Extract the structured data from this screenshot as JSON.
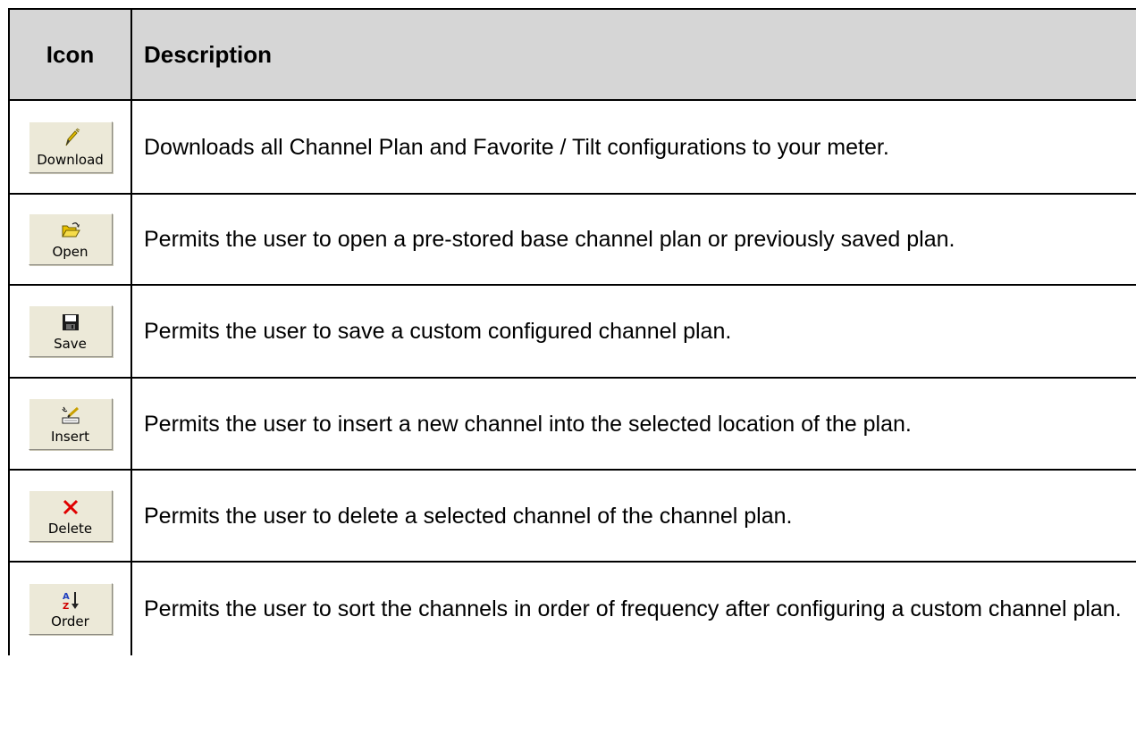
{
  "headers": {
    "icon": "Icon",
    "description": "Description"
  },
  "rows": [
    {
      "icon": "pencil-icon",
      "button_label": "Download",
      "description": "Downloads all Channel Plan and Favorite / Tilt configurations to your meter."
    },
    {
      "icon": "open-folder-icon",
      "button_label": "Open",
      "description": "Permits the user to open a pre-stored base channel plan or previously saved plan."
    },
    {
      "icon": "floppy-disk-icon",
      "button_label": "Save",
      "description": "Permits the user to save a custom configured channel plan."
    },
    {
      "icon": "insert-icon",
      "button_label": "Insert",
      "description": "Permits the user to insert a new channel into the selected location of the plan."
    },
    {
      "icon": "delete-x-icon",
      "button_label": "Delete",
      "description": "Permits the user to delete a selected channel of the channel plan."
    },
    {
      "icon": "sort-az-icon",
      "button_label": "Order",
      "description": "Permits the user to sort the channels in order of frequency after configuring a custom channel plan."
    }
  ],
  "colors": {
    "header_bg": "#d6d6d6",
    "button_bg": "#ece9d8",
    "delete_red": "#e00000",
    "sort_blue": "#1f3fbf"
  }
}
